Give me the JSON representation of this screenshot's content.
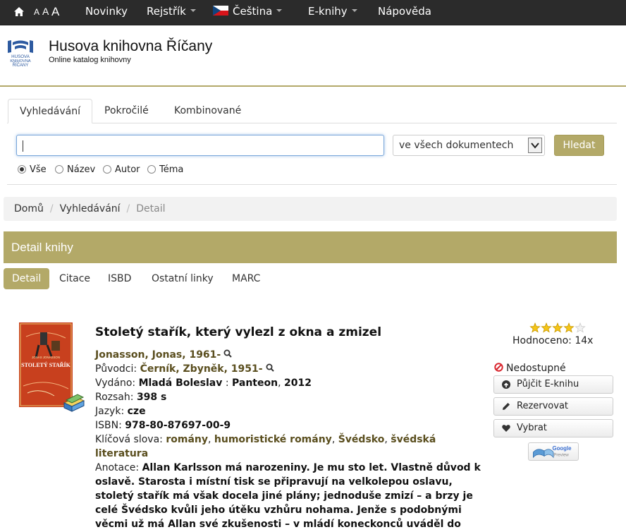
{
  "nav": {
    "font_sizes": [
      "A",
      "A",
      "A"
    ],
    "items": [
      {
        "label": "Novinky",
        "has_caret": false
      },
      {
        "label": "Rejstřík",
        "has_caret": true
      },
      {
        "label": "Čeština",
        "has_caret": true
      },
      {
        "label": "E-knihy",
        "has_caret": true
      },
      {
        "label": "Nápověda",
        "has_caret": false
      }
    ]
  },
  "header": {
    "logo_text": [
      "HUSOVA",
      "KNIHOVNA",
      "ŘÍČANY"
    ],
    "name": "Husova knihovna Říčany",
    "subtitle": "Online katalog knihovny"
  },
  "search": {
    "tabs": [
      "Vyhledávání",
      "Pokročilé",
      "Kombinované"
    ],
    "active_tab": "Vyhledávání",
    "query": "",
    "scope": "ve všech dokumentech",
    "button": "Hledat",
    "radios": [
      "Vše",
      "Název",
      "Autor",
      "Téma"
    ],
    "selected_radio": "Vše"
  },
  "breadcrumb": [
    "Domů",
    "Vyhledávání",
    "Detail"
  ],
  "detail": {
    "heading": "Detail knihy",
    "tabs": [
      "Detail",
      "Citace",
      "ISBD",
      "Ostatní linky",
      "MARC"
    ],
    "active_tab": "Detail"
  },
  "book": {
    "cover_text": {
      "author": "JONAS JONASSON",
      "title": "STOLETÝ STAŘÍK"
    },
    "title": "Stoletý stařík, který vylezl z okna a zmizel",
    "author": "Jonasson, Jonas, 1961-",
    "translator_label": "Původci:",
    "translator": "Černík, Zbyněk, 1951-",
    "published_label": "Vydáno:",
    "place": "Mladá Boleslav",
    "publisher": "Panteon",
    "year": "2012",
    "extent_label": "Rozsah:",
    "extent": "398 s",
    "language_label": "Jazyk:",
    "language": "cze",
    "isbn_label": "ISBN:",
    "isbn": "978-80-87697-00-9",
    "keywords_label": "Klíčová slova:",
    "keywords": [
      "romány",
      "humoristické romány",
      "Švédsko",
      "švédská literatura"
    ],
    "annotation_label": "Anotace:",
    "annotation": "Allan Karlsson má narozeniny. Je mu sto let. Vlastně důvod k oslavě. Starosta i místní tisk se připravují na velkolepou oslavu, stoletý stařík má však docela jiné plány; jednoduše zmizí – a brzy je celé Švédsko kvůli jeho útěku vzhůru nohama. Jenže s podobnými věcmi už má Allan své zkušenosti – v mládí koneckonců uváděl do"
  },
  "sidebar": {
    "rating": 4,
    "rating_max": 5,
    "rated_text": "Hodnoceno: 14x",
    "availability": "Nedostupné",
    "buttons": [
      "Půjčit E-knihu",
      "Rezervovat",
      "Vybrat"
    ],
    "google_preview": [
      "Google",
      "Preview"
    ]
  },
  "colors": {
    "accent": "#b3a968",
    "nav_bg": "#2b2b2b",
    "link_olive": "#5a4e1e",
    "unavailable_red": "#d9262e"
  }
}
